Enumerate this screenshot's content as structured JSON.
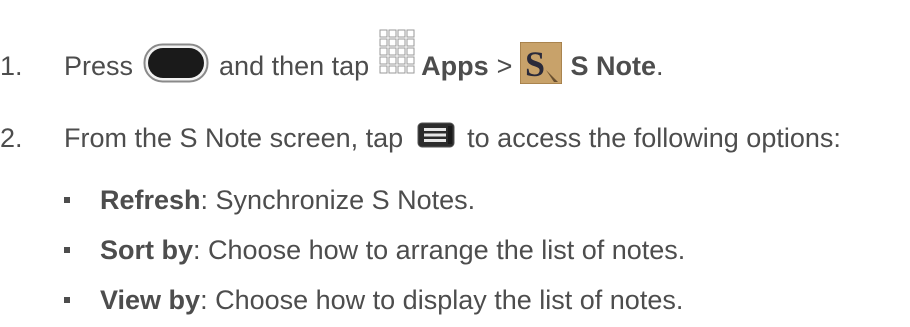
{
  "steps": [
    {
      "number": "1.",
      "text_press": "Press",
      "text_then": "and then tap",
      "apps_label": "Apps",
      "separator": ">",
      "snote_label": "S Note",
      "end": "."
    },
    {
      "number": "2.",
      "text_before": "From the S Note screen, tap",
      "text_after": "to access the following options:"
    }
  ],
  "options": [
    {
      "term": "Refresh",
      "desc": ": Synchronize S Notes."
    },
    {
      "term": "Sort by",
      "desc": ": Choose how to arrange the list of notes."
    },
    {
      "term": "View by",
      "desc": ": Choose how to display the list of notes."
    }
  ],
  "icons": {
    "home_key": "home-key-icon",
    "apps": "apps-grid-icon",
    "snote": "s-note-app-icon",
    "menu_key": "menu-key-icon"
  },
  "colors": {
    "text": "#4d4d4d",
    "snote_bg": "#c8a26a"
  }
}
